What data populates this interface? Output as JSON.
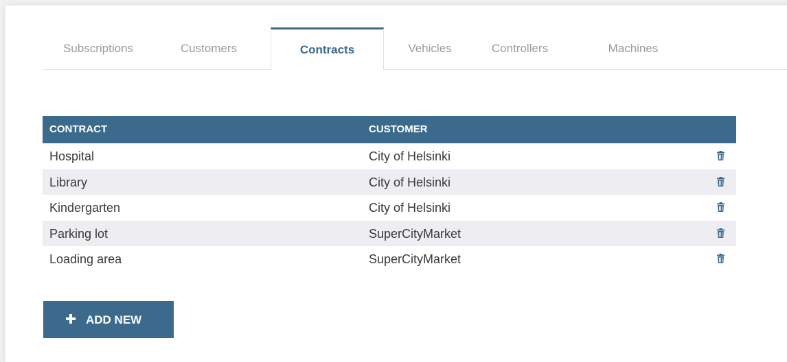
{
  "tabs": [
    {
      "label": "Subscriptions",
      "active": false
    },
    {
      "label": "Customers",
      "active": false
    },
    {
      "label": "Contracts",
      "active": true
    },
    {
      "label": "Vehicles",
      "active": false
    },
    {
      "label": "Controllers",
      "active": false
    },
    {
      "label": "Machines",
      "active": false
    }
  ],
  "table": {
    "headers": {
      "contract": "CONTRACT",
      "customer": "CUSTOMER"
    },
    "rows": [
      {
        "contract": "Hospital",
        "customer": "City of Helsinki",
        "action_icon": "trash-icon"
      },
      {
        "contract": "Library",
        "customer": "City of Helsinki",
        "action_icon": "trash-icon"
      },
      {
        "contract": "Kindergarten",
        "customer": "City of Helsinki",
        "action_icon": "trash-icon"
      },
      {
        "contract": "Parking lot",
        "customer": "SuperCityMarket",
        "action_icon": "trash-icon"
      },
      {
        "contract": "Loading area",
        "customer": "SuperCityMarket",
        "action_icon": "trash-icon"
      }
    ]
  },
  "add_button": {
    "label": "ADD NEW",
    "icon": "plus-icon"
  },
  "colors": {
    "accent": "#3b6a8d",
    "row_alt": "#ededf2",
    "inactive_tab_text": "#9b9b9b"
  }
}
